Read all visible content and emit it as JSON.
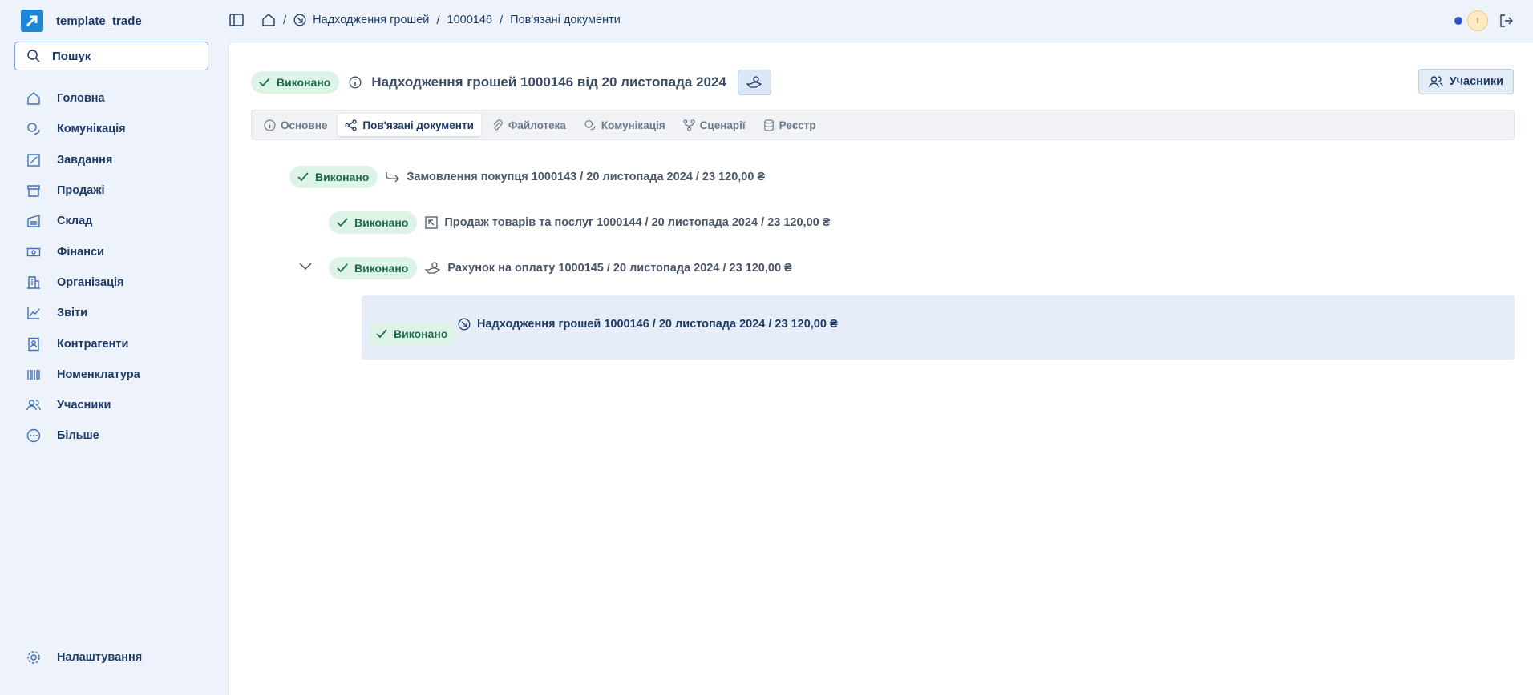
{
  "app": {
    "name": "template_trade"
  },
  "search": {
    "label": "Пошук"
  },
  "sidebar": {
    "items": [
      {
        "label": "Головна",
        "icon": "home-icon"
      },
      {
        "label": "Комунікація",
        "icon": "chat-icon"
      },
      {
        "label": "Завдання",
        "icon": "task-icon"
      },
      {
        "label": "Продажі",
        "icon": "store-icon"
      },
      {
        "label": "Склад",
        "icon": "warehouse-icon"
      },
      {
        "label": "Фінанси",
        "icon": "money-icon"
      },
      {
        "label": "Організація",
        "icon": "building-icon"
      },
      {
        "label": "Звіти",
        "icon": "chart-icon"
      },
      {
        "label": "Контрагенти",
        "icon": "contacts-icon"
      },
      {
        "label": "Номенклатура",
        "icon": "barcode-icon"
      },
      {
        "label": "Учасники",
        "icon": "users-icon"
      },
      {
        "label": "Більше",
        "icon": "more-icon"
      }
    ],
    "settings_label": "Налаштування"
  },
  "breadcrumb": {
    "section": "Надходження грошей",
    "doc_number": "1000146",
    "page": "Пов'язані документи"
  },
  "header": {
    "status": "Виконано",
    "title": "Надходження грошей 1000146 від 20 листопада 2024",
    "participants_label": "Учасники"
  },
  "tabs": [
    {
      "label": "Основне",
      "icon": "info-icon"
    },
    {
      "label": "Пов'язані документи",
      "icon": "relations-icon"
    },
    {
      "label": "Файлотека",
      "icon": "paperclip-icon"
    },
    {
      "label": "Комунікація",
      "icon": "chat-icon"
    },
    {
      "label": "Сценарії",
      "icon": "branch-icon"
    },
    {
      "label": "Реєстр",
      "icon": "database-icon"
    }
  ],
  "related": [
    {
      "status": "Виконано",
      "icon": "purchase-order-icon",
      "text": "Замовлення покупця 1000143 / 20 листопада 2024 / 23 120,00 ₴"
    },
    {
      "status": "Виконано",
      "icon": "sales-icon",
      "text": "Продаж товарів та послуг 1000144 / 20 листопада 2024 / 23 120,00 ₴"
    },
    {
      "status": "Виконано",
      "icon": "invoice-icon",
      "text": "Рахунок на оплату 1000145 / 20 листопада 2024 / 23 120,00 ₴"
    },
    {
      "status": "Виконано",
      "icon": "money-in-icon",
      "text": "Надходження грошей 1000146 / 20 листопада 2024 / 23 120,00 ₴"
    }
  ],
  "colors": {
    "accent": "#1f86d6",
    "status_bg": "#dcf3e6",
    "status_text": "#1c6b47",
    "current_row": "#e6edf8"
  }
}
